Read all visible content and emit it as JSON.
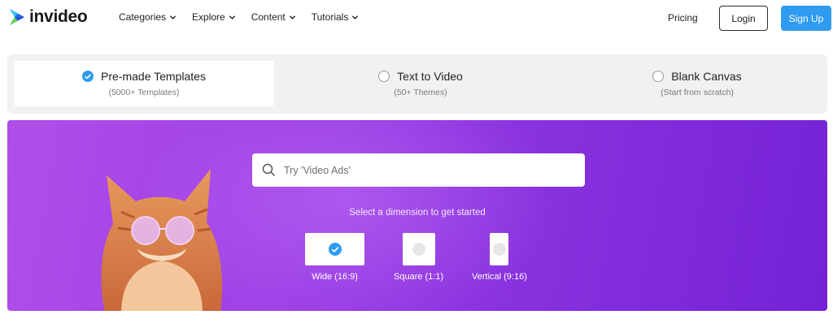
{
  "brand": {
    "name": "invideo"
  },
  "nav": {
    "items": [
      {
        "label": "Categories"
      },
      {
        "label": "Explore"
      },
      {
        "label": "Content"
      },
      {
        "label": "Tutorials"
      }
    ],
    "pricing": "Pricing",
    "login": "Login",
    "signup": "Sign Up"
  },
  "tabs": [
    {
      "title": "Pre-made Templates",
      "subtitle": "(5000+ Templates)",
      "selected": true
    },
    {
      "title": "Text to Video",
      "subtitle": "(50+ Themes)",
      "selected": false
    },
    {
      "title": "Blank Canvas",
      "subtitle": "(Start from scratch)",
      "selected": false
    }
  ],
  "hero": {
    "search_placeholder": "Try 'Video Ads'",
    "dimension_prompt": "Select a dimension to get started",
    "dimensions": [
      {
        "label": "Wide (16:9)",
        "selected": true
      },
      {
        "label": "Square (1:1)",
        "selected": false
      },
      {
        "label": "Vertical (9:16)",
        "selected": false
      }
    ]
  },
  "colors": {
    "accent": "#2f9bf0",
    "hero_start": "#b04ee8",
    "hero_end": "#7422d6",
    "tab_bg": "#f1f1f1"
  },
  "icons": [
    "invideo-logo-icon",
    "chevron-down-icon",
    "check-icon",
    "search-icon"
  ]
}
